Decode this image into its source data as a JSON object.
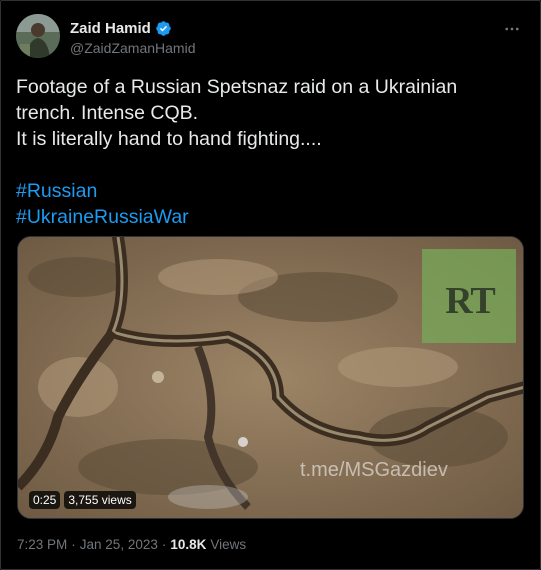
{
  "author": {
    "display_name": "Zaid Hamid",
    "handle": "@ZaidZamanHamid",
    "verified": true
  },
  "tweet": {
    "text_lines": [
      "Footage of a Russian Spetsnaz raid on a Ukrainian",
      "trench. Intense CQB.",
      "It is literally hand to hand fighting...."
    ],
    "hashtags": [
      "#Russian",
      "#UkraineRussiaWar"
    ]
  },
  "media": {
    "logo_text": "RT",
    "watermark": "t.me/MSGazdiev",
    "duration": "0:25",
    "views_badge": "3,755 views"
  },
  "meta": {
    "time": "7:23 PM",
    "separator": "·",
    "date": "Jan 25, 2023",
    "views_count": "10.8K",
    "views_label": "Views"
  },
  "icons": {
    "more": "more-horizontal-icon",
    "verified": "verified-badge-icon"
  },
  "colors": {
    "background": "#000000",
    "text": "#e7e9ea",
    "secondary": "#71767b",
    "link": "#1d9bf0",
    "verified": "#1d9bf0"
  }
}
